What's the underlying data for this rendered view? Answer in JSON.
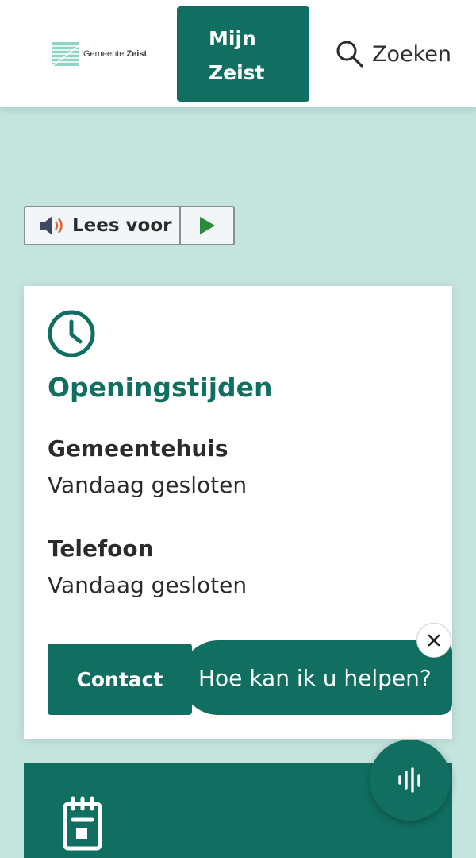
{
  "header": {
    "logo": {
      "municipality_prefix": "Gemeente",
      "municipality_name": "Zeist"
    },
    "mijn_zeist": {
      "line1": "Mijn",
      "line2": "Zeist"
    },
    "search": {
      "label": "Zoeken",
      "icon": "search-icon"
    }
  },
  "readspeaker": {
    "label": "Lees voor",
    "icons": [
      "speaker-icon",
      "play-icon"
    ]
  },
  "opening_hours": {
    "icon": "clock-icon",
    "title": "Openingstijden",
    "sections": [
      {
        "heading": "Gemeentehuis",
        "status": "Vandaag gesloten"
      },
      {
        "heading": "Telefoon",
        "status": "Vandaag gesloten"
      }
    ]
  },
  "contact": {
    "label": "Contact"
  },
  "chat": {
    "prompt": "Hoe kan ik u helpen?",
    "close_icon": "close-icon",
    "voice_icon": "voice-wave-icon"
  },
  "agenda": {
    "icon": "calendar-icon"
  },
  "colors": {
    "brand": "#116f62",
    "page_bg": "#c4e4de",
    "play_green": "#2a8a3a",
    "speaker_orange": "#e0612a"
  }
}
